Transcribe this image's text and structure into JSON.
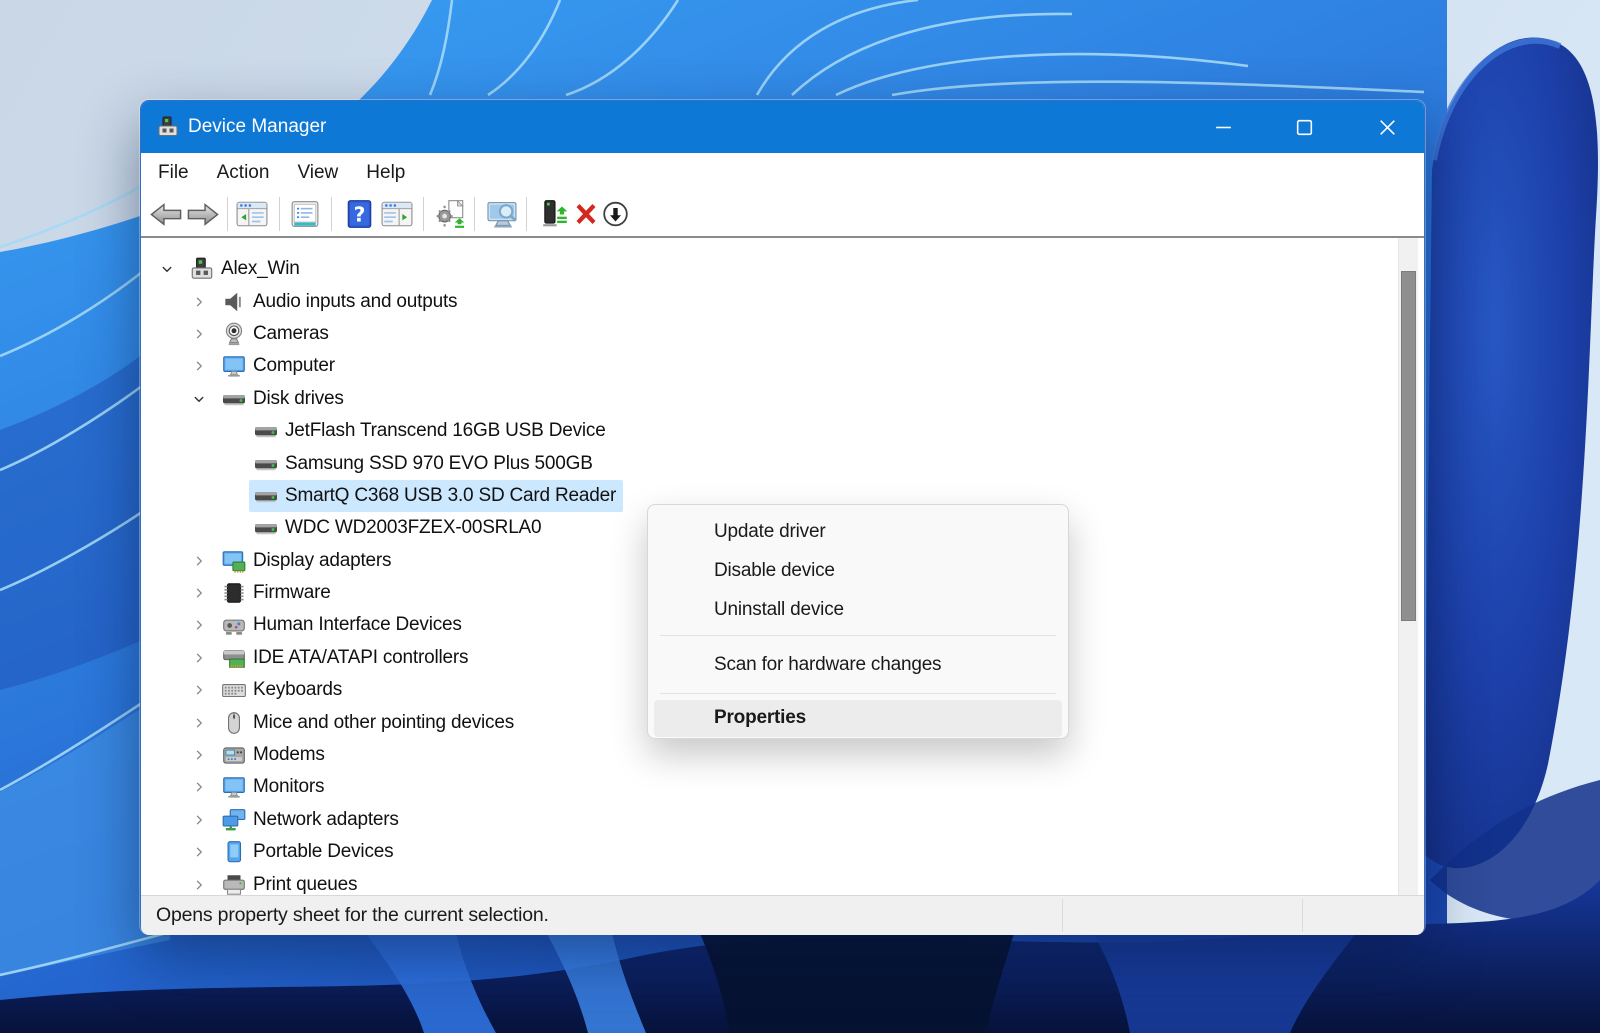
{
  "desktop": {
    "wallpaper": "windows-11-bloom-blue"
  },
  "window": {
    "title": "Device Manager",
    "menu_bar": {
      "items": [
        "File",
        "Action",
        "View",
        "Help"
      ]
    },
    "toolbar": {
      "buttons": [
        {
          "name": "back"
        },
        {
          "name": "forward"
        },
        {
          "name": "show-console-tree"
        },
        {
          "name": "properties"
        },
        {
          "name": "help"
        },
        {
          "name": "action-pane"
        },
        {
          "name": "update-driver-scan"
        },
        {
          "name": "scan-hardware-changes"
        },
        {
          "name": "update-device"
        },
        {
          "name": "uninstall-device"
        },
        {
          "name": "disable-device"
        }
      ]
    },
    "tree": {
      "nodes": [
        {
          "level": 0,
          "chevron": "expanded",
          "icon": "computer-root",
          "label": "Alex_Win",
          "selected": false
        },
        {
          "level": 1,
          "chevron": "collapsed",
          "icon": "audio",
          "label": "Audio inputs and outputs",
          "selected": false
        },
        {
          "level": 1,
          "chevron": "collapsed",
          "icon": "camera",
          "label": "Cameras",
          "selected": false
        },
        {
          "level": 1,
          "chevron": "collapsed",
          "icon": "monitor",
          "label": "Computer",
          "selected": false
        },
        {
          "level": 1,
          "chevron": "expanded",
          "icon": "disk",
          "label": "Disk drives",
          "selected": false
        },
        {
          "level": 2,
          "chevron": "none",
          "icon": "disk",
          "label": "JetFlash Transcend 16GB USB Device",
          "selected": false
        },
        {
          "level": 2,
          "chevron": "none",
          "icon": "disk",
          "label": "Samsung SSD 970 EVO Plus 500GB",
          "selected": false
        },
        {
          "level": 2,
          "chevron": "none",
          "icon": "disk",
          "label": "SmartQ C368 USB 3.0 SD Card Reader",
          "selected": true
        },
        {
          "level": 2,
          "chevron": "none",
          "icon": "disk",
          "label": "WDC WD2003FZEX-00SRLA0",
          "selected": false
        },
        {
          "level": 1,
          "chevron": "collapsed",
          "icon": "display-adapter",
          "label": "Display adapters",
          "selected": false
        },
        {
          "level": 1,
          "chevron": "collapsed",
          "icon": "firmware",
          "label": "Firmware",
          "selected": false
        },
        {
          "level": 1,
          "chevron": "collapsed",
          "icon": "hid",
          "label": "Human Interface Devices",
          "selected": false
        },
        {
          "level": 1,
          "chevron": "collapsed",
          "icon": "ide",
          "label": "IDE ATA/ATAPI controllers",
          "selected": false
        },
        {
          "level": 1,
          "chevron": "collapsed",
          "icon": "keyboard",
          "label": "Keyboards",
          "selected": false
        },
        {
          "level": 1,
          "chevron": "collapsed",
          "icon": "mouse",
          "label": "Mice and other pointing devices",
          "selected": false
        },
        {
          "level": 1,
          "chevron": "collapsed",
          "icon": "modem",
          "label": "Modems",
          "selected": false
        },
        {
          "level": 1,
          "chevron": "collapsed",
          "icon": "monitor",
          "label": "Monitors",
          "selected": false
        },
        {
          "level": 1,
          "chevron": "collapsed",
          "icon": "network",
          "label": "Network adapters",
          "selected": false
        },
        {
          "level": 1,
          "chevron": "collapsed",
          "icon": "portable",
          "label": "Portable Devices",
          "selected": false
        },
        {
          "level": 1,
          "chevron": "collapsed",
          "icon": "printer",
          "label": "Print queues",
          "selected": false
        }
      ]
    },
    "context_menu": {
      "items": [
        {
          "type": "item",
          "label": "Update driver",
          "bold": false,
          "highlighted": false
        },
        {
          "type": "item",
          "label": "Disable device",
          "bold": false,
          "highlighted": false
        },
        {
          "type": "item",
          "label": "Uninstall device",
          "bold": false,
          "highlighted": false
        },
        {
          "type": "separator"
        },
        {
          "type": "item",
          "label": "Scan for hardware changes",
          "bold": false,
          "highlighted": false
        },
        {
          "type": "separator"
        },
        {
          "type": "item",
          "label": "Properties",
          "bold": true,
          "highlighted": true
        }
      ]
    },
    "status_bar": {
      "text": "Opens property sheet for the current selection."
    },
    "colors": {
      "titlebar": "#0e78d6",
      "selection": "#cce8ff",
      "menu_highlight": "#ececec"
    }
  }
}
